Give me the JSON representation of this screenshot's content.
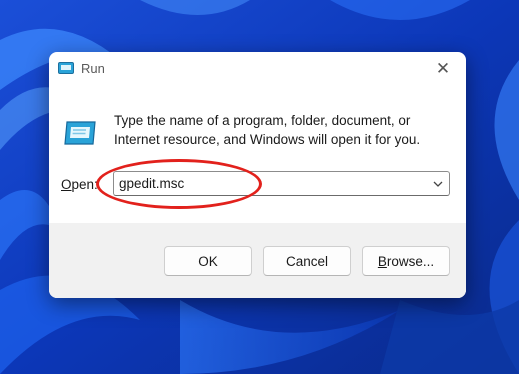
{
  "dialog": {
    "title": "Run",
    "close_glyph": "✕",
    "icons": {
      "title_icon": "run-icon",
      "main_icon": "run-icon",
      "close": "close-icon",
      "dropdown": "chevron-down-icon"
    },
    "message": "Type the name of a program, folder, document, or Internet resource, and Windows will open it for you.",
    "open_label_mnemonic": "O",
    "open_label_rest": "pen:",
    "open_value": "gpedit.msc",
    "buttons": {
      "ok": "OK",
      "cancel": "Cancel",
      "browse_mnemonic": "B",
      "browse_rest": "rowse..."
    }
  },
  "colors": {
    "highlight": "#e2211c",
    "dialog_bg": "#ffffff",
    "footer_bg": "#f1f1f1",
    "wallpaper": "#0a2f9e"
  }
}
